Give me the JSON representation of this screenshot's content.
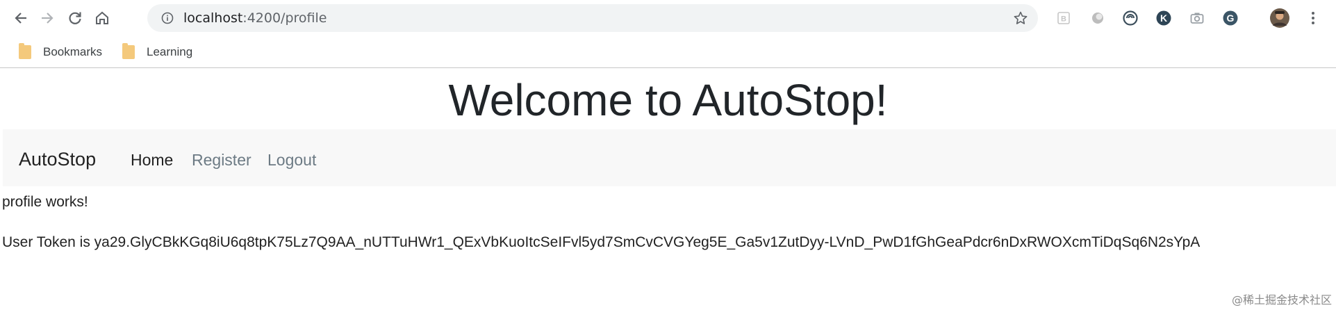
{
  "browser": {
    "url_host": "localhost",
    "url_rest": ":4200/profile",
    "icons": {
      "back": "back-arrow-icon",
      "forward": "forward-arrow-icon",
      "reload": "reload-icon",
      "home": "home-icon",
      "info": "info-icon",
      "star": "star-icon",
      "menu": "menu-dots-icon"
    },
    "extensions": [
      "b-extension-icon",
      "circle-extension-icon",
      "spiral-extension-icon",
      "k-extension-icon",
      "camera-extension-icon",
      "g-extension-icon",
      "profile-avatar-icon"
    ]
  },
  "bookmarks": [
    {
      "label": "Bookmarks"
    },
    {
      "label": "Learning"
    }
  ],
  "page": {
    "title": "Welcome to AutoStop!",
    "navbar": {
      "brand": "AutoStop",
      "links": [
        {
          "label": "Home"
        },
        {
          "label": "Register"
        },
        {
          "label": "Logout"
        }
      ]
    },
    "content": {
      "line1": "profile works!",
      "line2": "User Token is ya29.GlyCBkKGq8iU6q8tpK75Lz7Q9AA_nUTTuHWr1_QExVbKuoItcSeIFvl5yd7SmCvCVGYeg5E_Ga5v1ZutDyy-LVnD_PwD1fGhGeaPdcr6nDxRWOXcmTiDqSq6N2sYpA"
    }
  },
  "watermark": "@稀土掘金技术社区",
  "colors": {
    "omnibox_bg": "#f1f3f4",
    "navbar_bg": "#f8f8f8",
    "link_muted": "#6c7a84",
    "folder": "#f4c97c"
  }
}
